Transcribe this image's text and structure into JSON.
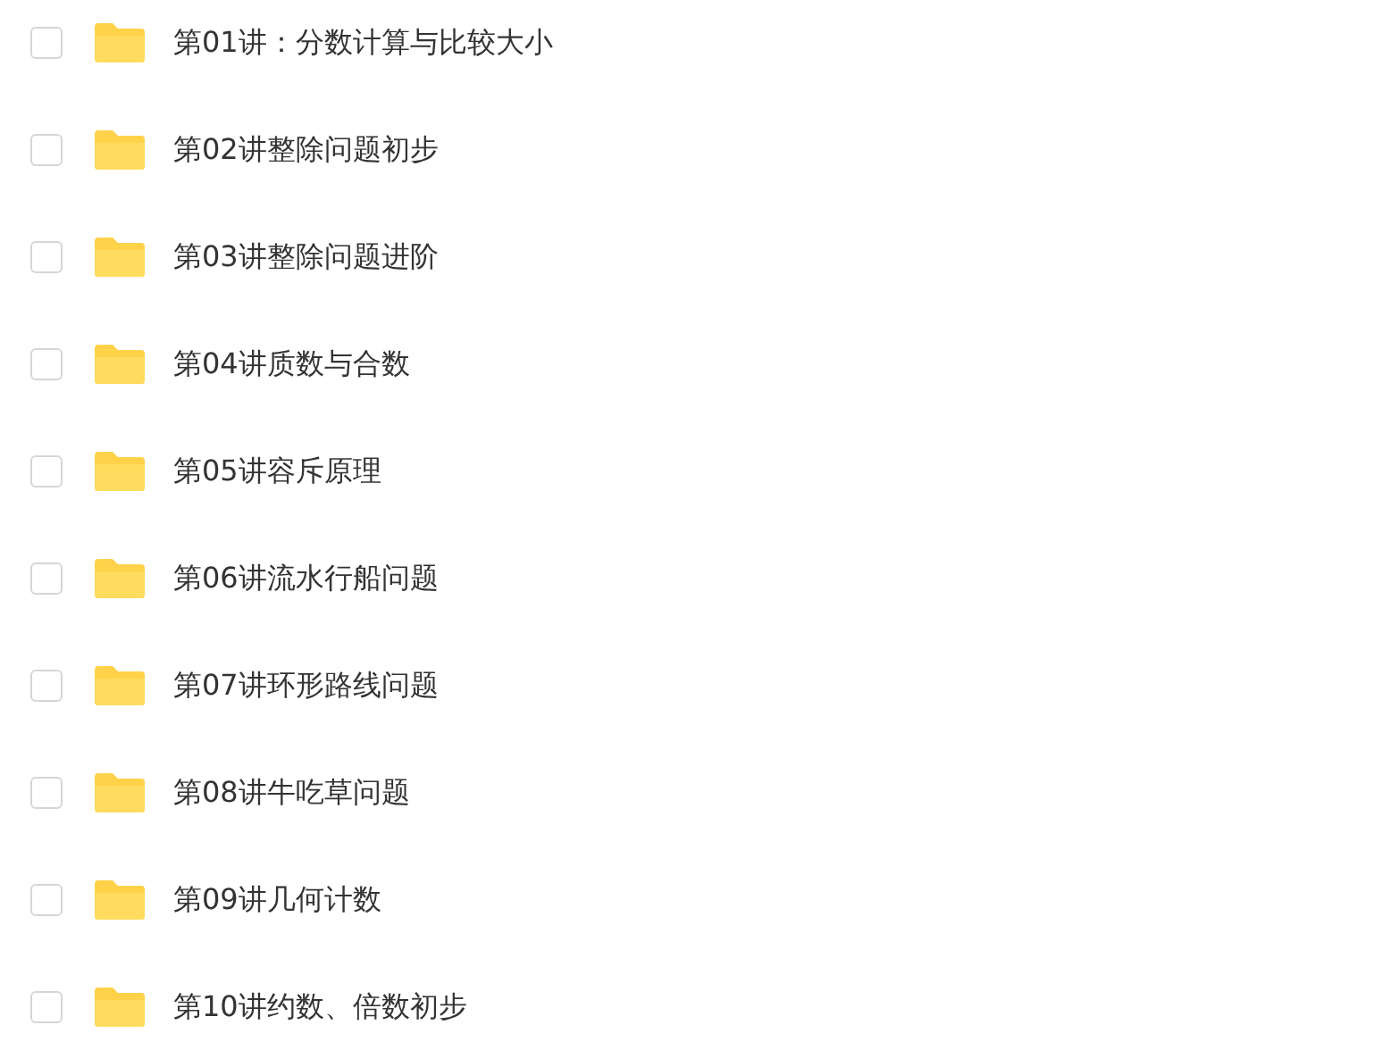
{
  "files": [
    {
      "name": "第01讲：分数计算与比较大小",
      "checked": false
    },
    {
      "name": "第02讲整除问题初步",
      "checked": false
    },
    {
      "name": "第03讲整除问题进阶",
      "checked": false
    },
    {
      "name": "第04讲质数与合数",
      "checked": false
    },
    {
      "name": "第05讲容斥原理",
      "checked": false
    },
    {
      "name": "第06讲流水行船问题",
      "checked": false
    },
    {
      "name": "第07讲环形路线问题",
      "checked": false
    },
    {
      "name": "第08讲牛吃草问题",
      "checked": false
    },
    {
      "name": "第09讲几何计数",
      "checked": false
    },
    {
      "name": "第10讲约数、倍数初步",
      "checked": false
    }
  ]
}
